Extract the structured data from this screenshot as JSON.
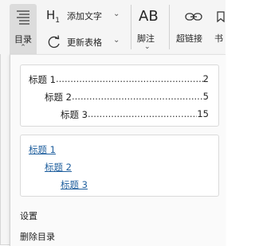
{
  "ribbon": {
    "toc_label": "目录",
    "add_text_label": "添加文字",
    "add_text_heading_glyph": "H",
    "add_text_heading_sub": "1",
    "update_table_label": "更新表格",
    "footnote_label": "脚注",
    "footnote_glyph": "AB",
    "hyperlink_label": "超链接",
    "bookmark_label": "书",
    "chevron_down": "⌄",
    "chevron_up": "⌃"
  },
  "toc_panel": {
    "plain_style": [
      {
        "title": "标题 1",
        "page": "2"
      },
      {
        "title": "标题 2",
        "page": "5"
      },
      {
        "title": "标题 3",
        "page": "15"
      }
    ],
    "link_style": [
      {
        "title": "标题 1"
      },
      {
        "title": "标题 2"
      },
      {
        "title": "标题 3"
      }
    ],
    "leader_dots": "..................................................................................................................",
    "settings_label": "设置",
    "delete_label": "删除目录"
  }
}
